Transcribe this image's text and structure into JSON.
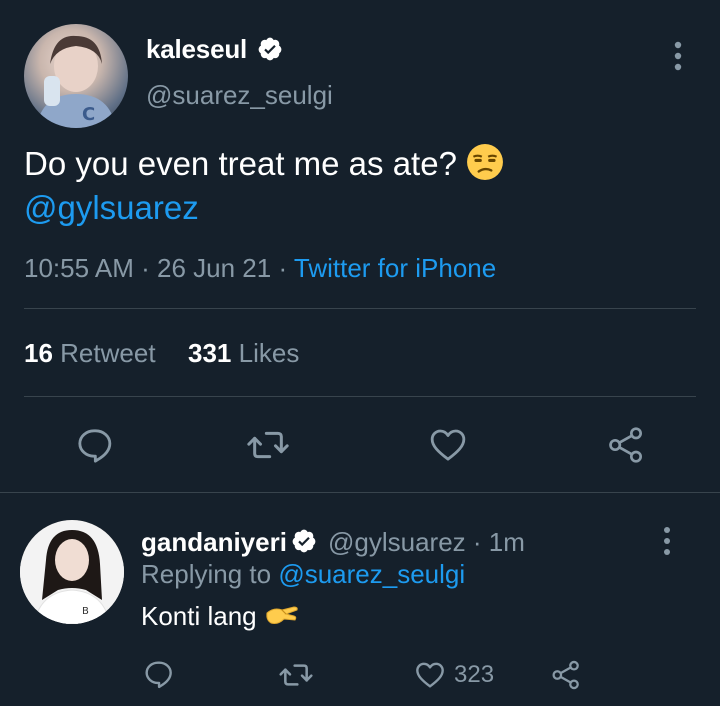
{
  "main_tweet": {
    "author": {
      "display_name": "kaleseul",
      "handle": "@suarez_seulgi",
      "verified": true
    },
    "text": "Do you even treat me as ate?",
    "emoji": "unamused-face",
    "mention": "@gylsuarez",
    "time": "10:55 AM",
    "date": "26 Jun 21",
    "source": "Twitter for iPhone",
    "separator": "·",
    "stats": {
      "retweets_count": "16",
      "retweets_label": "Retweet",
      "likes_count": "331",
      "likes_label": "Likes"
    },
    "actions": [
      "reply-icon",
      "retweet-icon",
      "like-icon",
      "share-icon"
    ]
  },
  "reply": {
    "author": {
      "display_name": "gandaniyeri",
      "handle": "@gylsuarez",
      "verified": true
    },
    "age": "· 1m",
    "replying_to_label": "Replying to",
    "replying_to_handle": "@suarez_seulgi",
    "text": "Konti lang",
    "emoji": "pinching-hand",
    "like_count": "323",
    "actions": [
      "reply-icon",
      "retweet-icon",
      "like-icon",
      "share-icon"
    ]
  },
  "colors": {
    "background": "#15202b",
    "text_primary": "#ffffff",
    "text_secondary": "#8899a6",
    "accent": "#1d9bf0",
    "divider": "#38444d"
  }
}
